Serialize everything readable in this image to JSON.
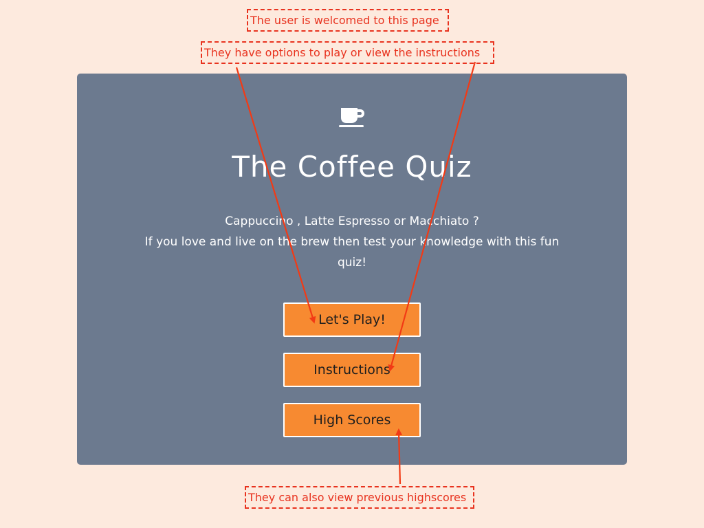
{
  "annotations": {
    "welcome": "The user is welcomed to this page",
    "options": "They have options to play or view the instructions",
    "highscores": "They can also view previous highscores"
  },
  "header": {
    "icon": "coffee-cup-icon",
    "title": "The Coffee Quiz"
  },
  "description": {
    "line1": "Cappuccino , Latte Espresso or Macchiato ?",
    "line2": "If you love and live on the brew then test your knowledge with this fun quiz!"
  },
  "buttons": {
    "play": "Let's Play!",
    "instructions": "Instructions",
    "highscores": "High Scores"
  },
  "colors": {
    "page_background": "#fdeade",
    "card_background": "#6c7a8f",
    "button_background": "#f78a31",
    "annotation": "#e8321e"
  }
}
